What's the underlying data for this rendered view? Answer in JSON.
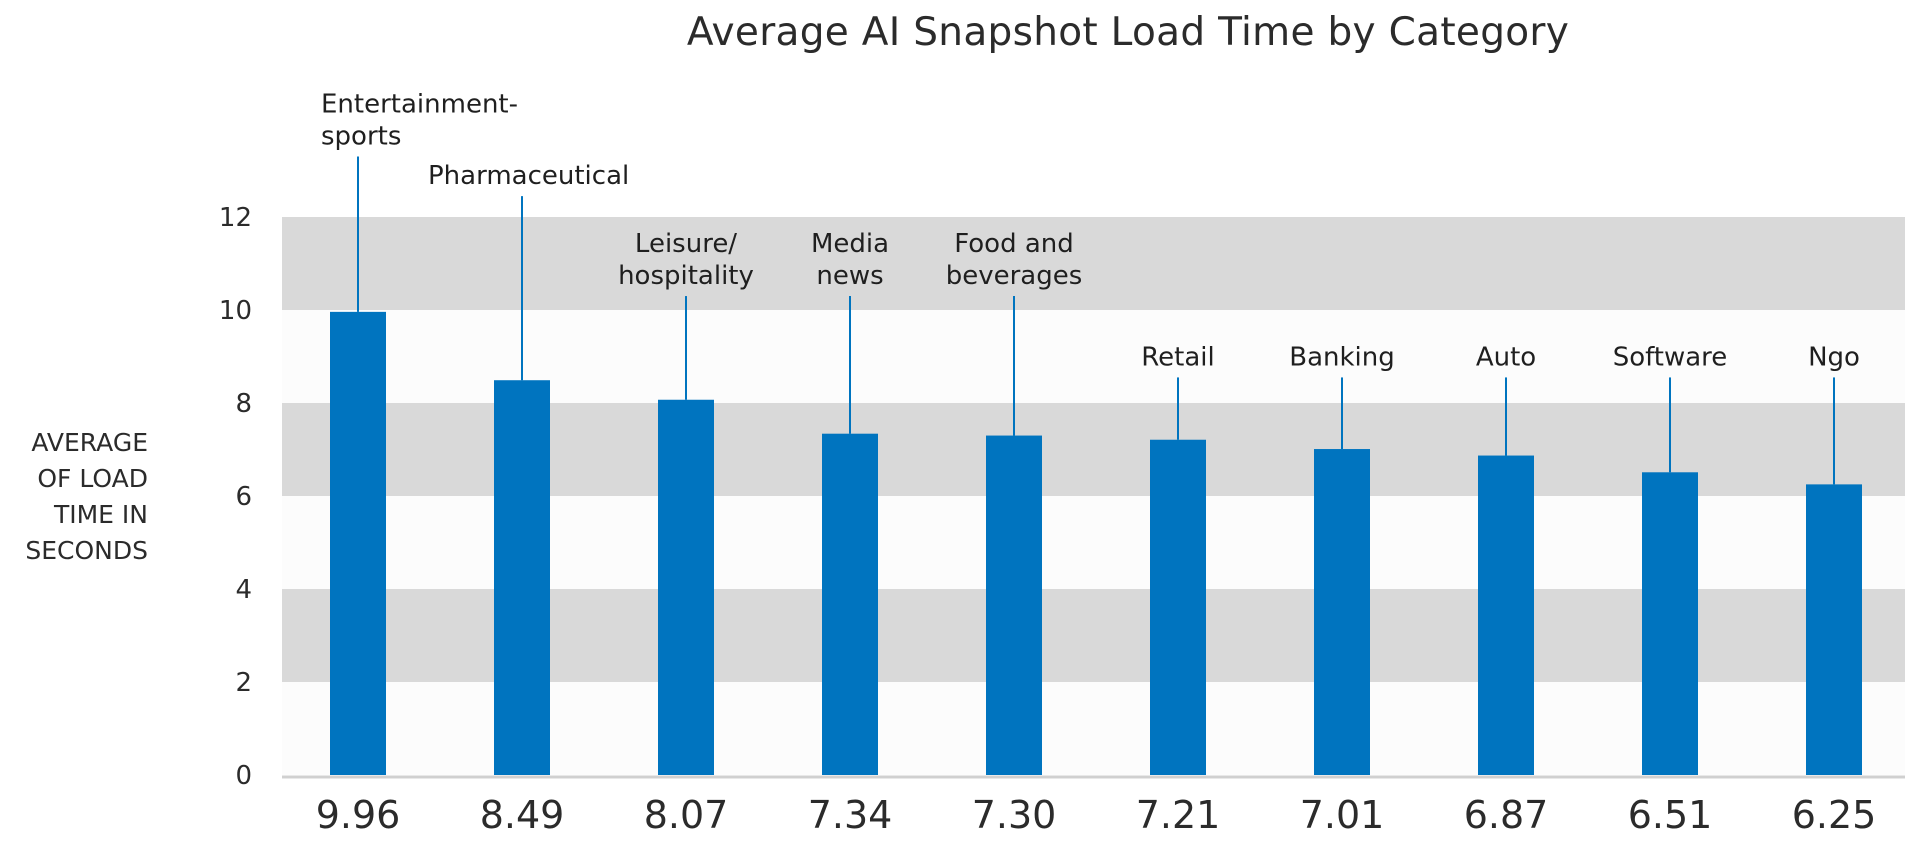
{
  "chart_data": {
    "type": "bar",
    "title": "Average AI Snapshot Load Time by Category",
    "xlabel": "",
    "ylabel": [
      "AVERAGE",
      "OF LOAD",
      "TIME IN",
      "SECONDS"
    ],
    "ylim": [
      0,
      12
    ],
    "yticks": [
      0,
      2,
      4,
      6,
      8,
      10,
      12
    ],
    "grid": "alternating horizontal bands",
    "colors": {
      "bar": "#0074BF",
      "band": "#D9D9D9",
      "band_alt": "#FCFCFC",
      "leader": "#0074BF"
    },
    "categories": [
      [
        "Entertainment-",
        "sports"
      ],
      [
        "Pharmaceutical"
      ],
      [
        "Leisure/",
        "hospitality"
      ],
      [
        "Media",
        "news"
      ],
      [
        "Food and",
        "beverages"
      ],
      [
        "Retail"
      ],
      [
        "Banking"
      ],
      [
        "Auto"
      ],
      [
        "Software"
      ],
      [
        "Ngo"
      ]
    ],
    "values": [
      9.96,
      8.49,
      8.07,
      7.34,
      7.3,
      7.21,
      7.01,
      6.87,
      6.51,
      6.25
    ],
    "value_labels": [
      "9.96",
      "8.49",
      "8.07",
      "7.34",
      "7.30",
      "7.21",
      "7.01",
      "6.87",
      "6.51",
      "6.25"
    ],
    "label_top_values": [
      13.3,
      12.45,
      10.3,
      10.3,
      10.3,
      8.55,
      8.55,
      8.55,
      8.55,
      8.55
    ]
  }
}
